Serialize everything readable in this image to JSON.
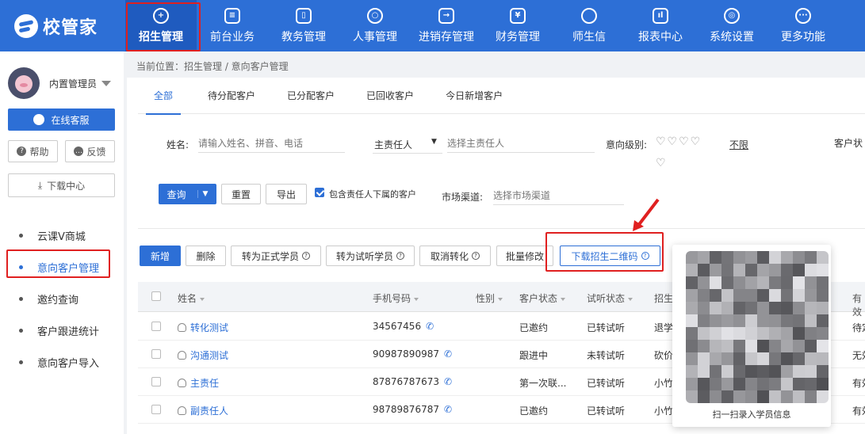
{
  "app": {
    "logo_text": "校管家"
  },
  "nav": [
    {
      "label": "招生管理",
      "icon": "user-plus-icon",
      "glyph": "+"
    },
    {
      "label": "前台业务",
      "icon": "monitor-icon",
      "glyph": "≡"
    },
    {
      "label": "教务管理",
      "icon": "book-icon",
      "glyph": "▯"
    },
    {
      "label": "人事管理",
      "icon": "person-icon",
      "glyph": "○"
    },
    {
      "label": "进销存管理",
      "icon": "inventory-icon",
      "glyph": "→"
    },
    {
      "label": "财务管理",
      "icon": "finance-icon",
      "glyph": "¥"
    },
    {
      "label": "师生信",
      "icon": "message-icon",
      "glyph": ""
    },
    {
      "label": "报表中心",
      "icon": "chart-icon",
      "glyph": "ıl"
    },
    {
      "label": "系统设置",
      "icon": "settings-icon",
      "glyph": "◎"
    },
    {
      "label": "更多功能",
      "icon": "more-icon",
      "glyph": "···"
    }
  ],
  "sidebar": {
    "user_name": "内置管理员",
    "service_label": "在线客服",
    "help_label": "帮助",
    "feedback_label": "反馈",
    "download_label": "下载中心",
    "items": [
      {
        "label": "云课V商城"
      },
      {
        "label": "意向客户管理"
      },
      {
        "label": "邀约查询"
      },
      {
        "label": "客户跟进统计"
      },
      {
        "label": "意向客户导入"
      }
    ]
  },
  "breadcrumb": "当前位置：招生管理 / 意向客户管理",
  "tabs": [
    "全部",
    "待分配客户",
    "已分配客户",
    "已回收客户",
    "今日新增客户"
  ],
  "filters": {
    "name_label": "姓名:",
    "name_placeholder": "请输入姓名、拼音、电话",
    "owner_select": "主责任人",
    "owner_placeholder": "选择主责任人",
    "intent_label": "意向级别:",
    "hearts": "♡♡♡♡",
    "hearts2": "♡",
    "unlimited": "不限",
    "status_label": "客户状",
    "query_label": "查询",
    "reset_label": "重置",
    "export_label": "导出",
    "include_sub_label": "包含责任人下属的客户",
    "channel_label": "市场渠道:",
    "channel_placeholder": "选择市场渠道"
  },
  "actions": {
    "add": "新增",
    "delete": "删除",
    "to_student": "转为正式学员",
    "to_trial": "转为试听学员",
    "cancel_convert": "取消转化",
    "batch_edit": "批量修改",
    "download_qr": "下载招生二维码"
  },
  "table": {
    "headers": [
      "姓名",
      "手机号码",
      "性别",
      "客户状态",
      "试听状态",
      "招生",
      "有效"
    ],
    "rows": [
      {
        "name": "转化测试",
        "phone": "34567456",
        "gender": "",
        "status": "已邀约",
        "trial": "已转试听",
        "source": "退学",
        "valid": "待定"
      },
      {
        "name": "沟通测试",
        "phone": "90987890987",
        "gender": "",
        "status": "跟进中",
        "trial": "未转试听",
        "source": "砍价",
        "valid": "无效"
      },
      {
        "name": "主责任",
        "phone": "87876787673",
        "gender": "",
        "status": "第一次联...",
        "trial": "已转试听",
        "source": "小竹",
        "valid": "有效"
      },
      {
        "name": "副责任人",
        "phone": "98789876787",
        "gender": "",
        "status": "已邀约",
        "trial": "已转试听",
        "source": "小竹",
        "valid": "有效"
      }
    ]
  },
  "qr_popup": {
    "caption": "扫一扫录入学员信息"
  },
  "colors": {
    "primary": "#2d6fd6",
    "highlight": "#e02020"
  }
}
